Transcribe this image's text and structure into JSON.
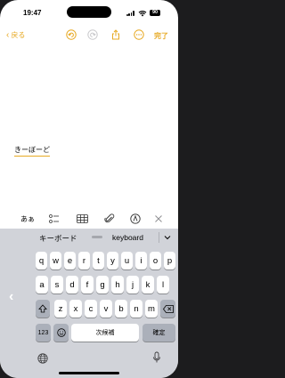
{
  "status": {
    "time": "19:47",
    "battery": "90"
  },
  "nav": {
    "back_label": "戻る",
    "done_label": "完了"
  },
  "note": {
    "text": "きーぼーど"
  },
  "toolbar": {
    "format_label": "あぁ"
  },
  "candidates": {
    "first": "キーボード",
    "second": "keyboard"
  },
  "keyboard": {
    "row1": [
      "q",
      "w",
      "e",
      "r",
      "t",
      "y",
      "u",
      "i",
      "o",
      "p"
    ],
    "row2": [
      "a",
      "s",
      "d",
      "f",
      "g",
      "h",
      "j",
      "k",
      "l"
    ],
    "row3": [
      "z",
      "x",
      "c",
      "v",
      "b",
      "n",
      "m"
    ],
    "mode_label": "123",
    "space_label": "次候補",
    "return_label": "確定"
  },
  "colors": {
    "accent": "#e7a923",
    "keyboard_bg": "#d1d3d9",
    "key_dark": "#abb0ba"
  }
}
